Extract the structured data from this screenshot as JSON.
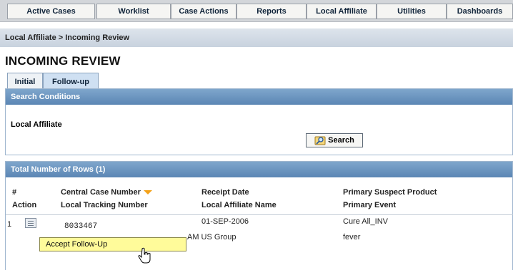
{
  "nav": {
    "tabs": [
      "Active Cases",
      "Worklist",
      "Case Actions",
      "Reports",
      "Local Affiliate",
      "Utilities",
      "Dashboards"
    ]
  },
  "breadcrumb": "Local Affiliate > Incoming Review",
  "page_title": "INCOMING REVIEW",
  "subtabs": [
    "Initial",
    "Follow-up"
  ],
  "search_panel": {
    "title": "Search Conditions",
    "local_affiliate_label": "Local Affiliate",
    "search_button": "Search"
  },
  "results_panel": {
    "title": "Total Number of Rows (1)",
    "headers": {
      "num": "#",
      "action": "Action",
      "central_case": "Central Case Number",
      "local_tracking": "Local Tracking Number",
      "receipt_date": "Receipt Date",
      "affiliate_name": "Local Affiliate Name",
      "suspect_product": "Primary Suspect Product",
      "primary_event": "Primary Event"
    },
    "rows": [
      {
        "num": "1",
        "central_case": "8033467",
        "receipt_date": "01-SEP-2006",
        "affiliate_name": "AM US Group",
        "suspect_product": "Cure All_INV",
        "primary_event": "fever"
      }
    ]
  },
  "popup_menu": {
    "item": "Accept Follow-Up"
  },
  "colors": {
    "panel_header": "#5b86b4",
    "popup_bg": "#fffb9a",
    "sort_arrow": "#f4a21a"
  }
}
